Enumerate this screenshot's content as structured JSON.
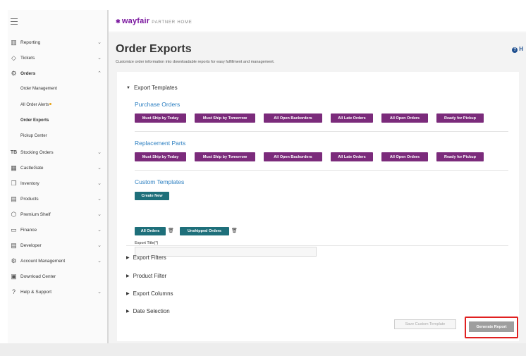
{
  "sidebar": {
    "items": [
      {
        "label": "Reporting",
        "icon": "bar-chart-icon",
        "glyph": "▥",
        "chevron": "⌄"
      },
      {
        "label": "Tickets",
        "icon": "diamond-icon",
        "glyph": "◇",
        "chevron": "⌄"
      },
      {
        "label": "Orders",
        "icon": "box-icon",
        "glyph": "⚙",
        "chevron": "⌃"
      },
      {
        "label": "Order Management"
      },
      {
        "label": "All Order Alerts"
      },
      {
        "label": "Order Exports"
      },
      {
        "label": "Pickup Center"
      },
      {
        "label": "Stocking Orders",
        "icon": "tb-icon",
        "glyph": "TB",
        "chevron": "⌄"
      },
      {
        "label": "CastleGate",
        "icon": "warehouse-icon",
        "glyph": "▦",
        "chevron": "⌄"
      },
      {
        "label": "Inventory",
        "icon": "boxes-icon",
        "glyph": "❒",
        "chevron": "⌄"
      },
      {
        "label": "Products",
        "icon": "products-icon",
        "glyph": "▤",
        "chevron": "⌄"
      },
      {
        "label": "Premium Shelf",
        "icon": "tag-icon",
        "glyph": "⬡",
        "chevron": "⌄"
      },
      {
        "label": "Finance",
        "icon": "finance-icon",
        "glyph": "▭",
        "chevron": "⌄"
      },
      {
        "label": "Developer",
        "icon": "developer-icon",
        "glyph": "▤",
        "chevron": "⌄"
      },
      {
        "label": "Account Management",
        "icon": "gear-icon",
        "glyph": "⚙",
        "chevron": "⌄"
      },
      {
        "label": "Download Center",
        "icon": "download-icon",
        "glyph": "▣"
      },
      {
        "label": "Help & Support",
        "icon": "question-icon",
        "glyph": "?",
        "chevron": "⌄"
      }
    ]
  },
  "header": {
    "logo": "wayfair",
    "logo_star": "✱",
    "logo_sub": "PARTNER HOME"
  },
  "main": {
    "title": "Order Exports",
    "help_text": "H",
    "help_glyph": "?",
    "description": "Customize order information into downloadable reports for easy fulfillment and management.",
    "export_templates": {
      "heading": "Export Templates",
      "triangle": "▼",
      "purchase_orders": {
        "title": "Purchase Orders",
        "buttons": [
          "Must Ship by Today",
          "Must Ship by Tomorrow",
          "All Open Backorders",
          "All Late Orders",
          "All Open Orders",
          "Ready for Pickup"
        ]
      },
      "replacement_parts": {
        "title": "Replacement Parts",
        "buttons": [
          "Must Ship by Today",
          "Must Ship by Tomorrow",
          "All Open Backorders",
          "All Late Orders",
          "All Open Orders",
          "Ready for Pickup"
        ]
      },
      "custom_templates": {
        "title": "Custom Templates",
        "create_new": "Create New",
        "field_label": "Export Title(*)",
        "field_value": "",
        "saved": [
          "All Orders",
          "Unshipped Orders"
        ],
        "trash_glyph": "🗑"
      }
    },
    "collapsed_sections": [
      {
        "label": "Export Filters",
        "triangle": "▶"
      },
      {
        "label": "Product Filter",
        "triangle": "▶"
      },
      {
        "label": "Export Columns",
        "triangle": "▶"
      },
      {
        "label": "Date Selection",
        "triangle": "▶"
      }
    ],
    "actions": {
      "save_template": "Save Custom Template",
      "generate_report": "Generate Report"
    }
  },
  "colors": {
    "brand_purple": "#7b189f",
    "template_button": "#7b2b7b",
    "teal_button": "#1e6f7a",
    "link_blue": "#2c7fc1",
    "highlight_red": "#e02020"
  }
}
